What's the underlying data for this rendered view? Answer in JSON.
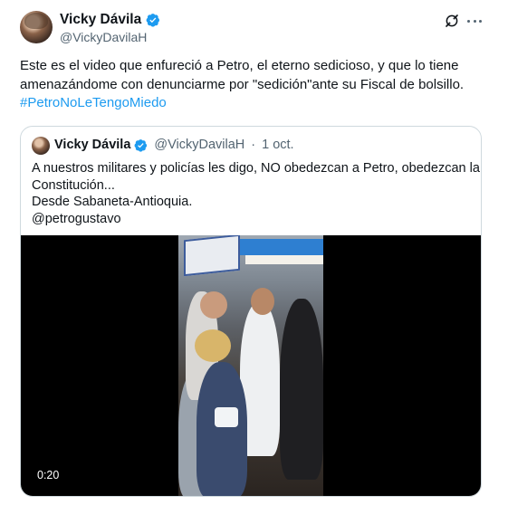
{
  "author": {
    "display_name": "Vicky Dávila",
    "handle": "@VickyDavilaH",
    "verified": true,
    "verified_color": "#1d9bf0"
  },
  "header_actions": {
    "grok_icon": "grok-icon",
    "more_icon": "more-icon"
  },
  "tweet": {
    "lines": [
      "Este es el video que enfureció a Petro, el eterno sedicioso, y que lo tiene",
      "amenazándome con denunciarme por \"sedición\"ante su Fiscal de bolsillo."
    ],
    "hashtag": "#PetroNoLeTengoMiedo",
    "hashtag_color": "#1d9bf0"
  },
  "quote": {
    "display_name": "Vicky Dávila",
    "handle": "@VickyDavilaH",
    "separator": "·",
    "date": "1 oct.",
    "lines": [
      "A nuestros militares y policías les digo, NO obedezcan a Petro, obedezcan la",
      "Constitución...",
      "Desde Sabaneta-Antioquia.",
      "@petrogustavo"
    ],
    "video": {
      "duration": "0:20"
    }
  }
}
